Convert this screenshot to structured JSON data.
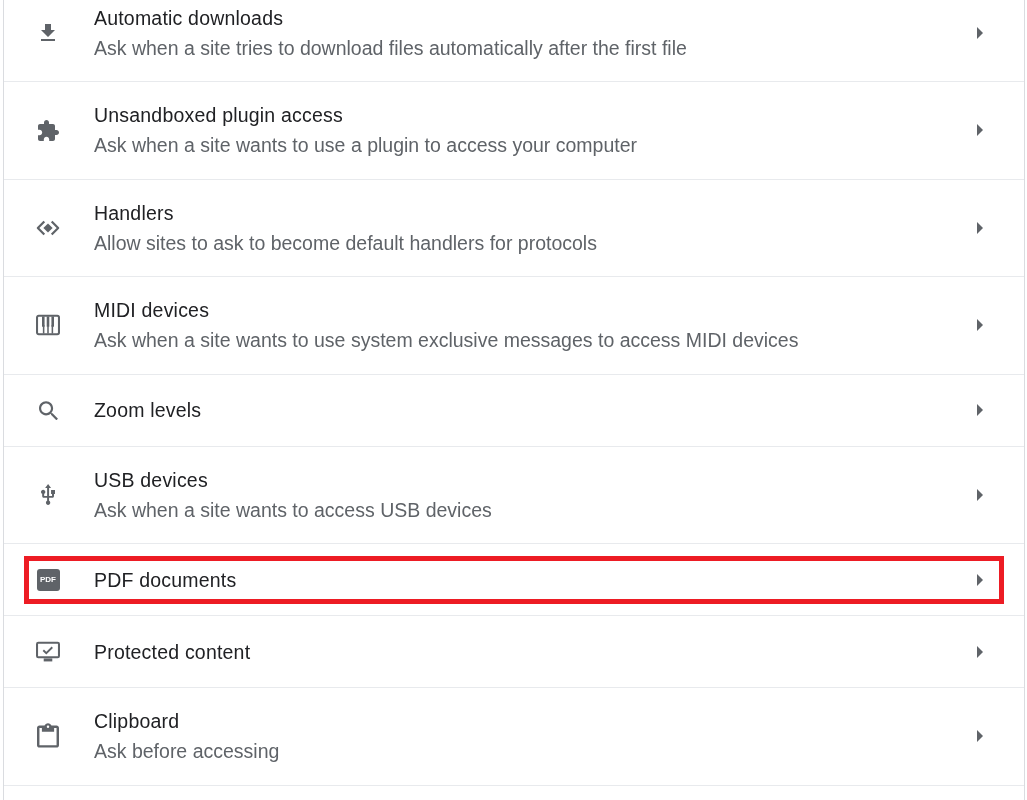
{
  "items": [
    {
      "title": "Automatic downloads",
      "description": "Ask when a site tries to download files automatically after the first file",
      "highlighted": false
    },
    {
      "title": "Unsandboxed plugin access",
      "description": "Ask when a site wants to use a plugin to access your computer",
      "highlighted": false
    },
    {
      "title": "Handlers",
      "description": "Allow sites to ask to become default handlers for protocols",
      "highlighted": false
    },
    {
      "title": "MIDI devices",
      "description": "Ask when a site wants to use system exclusive messages to access MIDI devices",
      "highlighted": false
    },
    {
      "title": "Zoom levels",
      "highlighted": false
    },
    {
      "title": "USB devices",
      "description": "Ask when a site wants to access USB devices",
      "highlighted": false
    },
    {
      "title": "PDF documents",
      "icon_text": "PDF",
      "highlighted": true
    },
    {
      "title": "Protected content",
      "highlighted": false
    },
    {
      "title": "Clipboard",
      "description": "Ask before accessing",
      "highlighted": false
    }
  ]
}
